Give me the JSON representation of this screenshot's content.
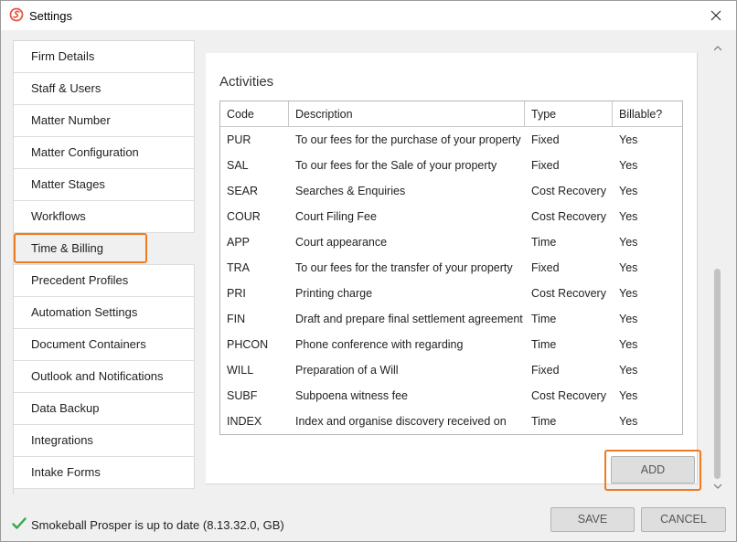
{
  "window": {
    "title": "Settings"
  },
  "sidebar": {
    "items": [
      {
        "label": "Firm Details",
        "active": false
      },
      {
        "label": "Staff & Users",
        "active": false
      },
      {
        "label": "Matter Number",
        "active": false
      },
      {
        "label": "Matter Configuration",
        "active": false
      },
      {
        "label": "Matter Stages",
        "active": false
      },
      {
        "label": "Workflows",
        "active": false
      },
      {
        "label": "Time & Billing",
        "active": true
      },
      {
        "label": "Precedent Profiles",
        "active": false
      },
      {
        "label": "Automation Settings",
        "active": false
      },
      {
        "label": "Document Containers",
        "active": false
      },
      {
        "label": "Outlook and Notifications",
        "active": false
      },
      {
        "label": "Data Backup",
        "active": false
      },
      {
        "label": "Integrations",
        "active": false
      },
      {
        "label": "Intake Forms",
        "active": false
      }
    ]
  },
  "activities": {
    "title": "Activities",
    "columns": [
      "Code",
      "Description",
      "Type",
      "Billable?"
    ],
    "rows": [
      [
        "PUR",
        "To our fees for the purchase of your property",
        "Fixed",
        "Yes"
      ],
      [
        "SAL",
        "To our fees for the Sale of your property",
        "Fixed",
        "Yes"
      ],
      [
        "SEAR",
        "Searches & Enquiries",
        "Cost Recovery",
        "Yes"
      ],
      [
        "COUR",
        "Court Filing Fee",
        "Cost Recovery",
        "Yes"
      ],
      [
        "APP",
        "Court appearance",
        "Time",
        "Yes"
      ],
      [
        "TRA",
        "To our fees for the transfer of your property",
        "Fixed",
        "Yes"
      ],
      [
        "PRI",
        "Printing charge",
        "Cost Recovery",
        "Yes"
      ],
      [
        "FIN",
        "Draft and prepare final settlement agreement",
        "Time",
        "Yes"
      ],
      [
        "PHCON",
        "Phone conference with   regarding",
        "Time",
        "Yes"
      ],
      [
        "WILL",
        "Preparation of a Will",
        "Fixed",
        "Yes"
      ],
      [
        "SUBF",
        "Subpoena witness fee",
        "Cost Recovery",
        "Yes"
      ],
      [
        "INDEX",
        "Index and organise discovery received on",
        "Time",
        "Yes"
      ]
    ],
    "add_label": "ADD"
  },
  "footer": {
    "status": "Smokeball Prosper is up to date (8.13.32.0, GB)",
    "save_label": "SAVE",
    "cancel_label": "CANCEL"
  },
  "colors": {
    "highlight": "#f07a20",
    "brand": "#e8573c",
    "check": "#3aa54a"
  }
}
